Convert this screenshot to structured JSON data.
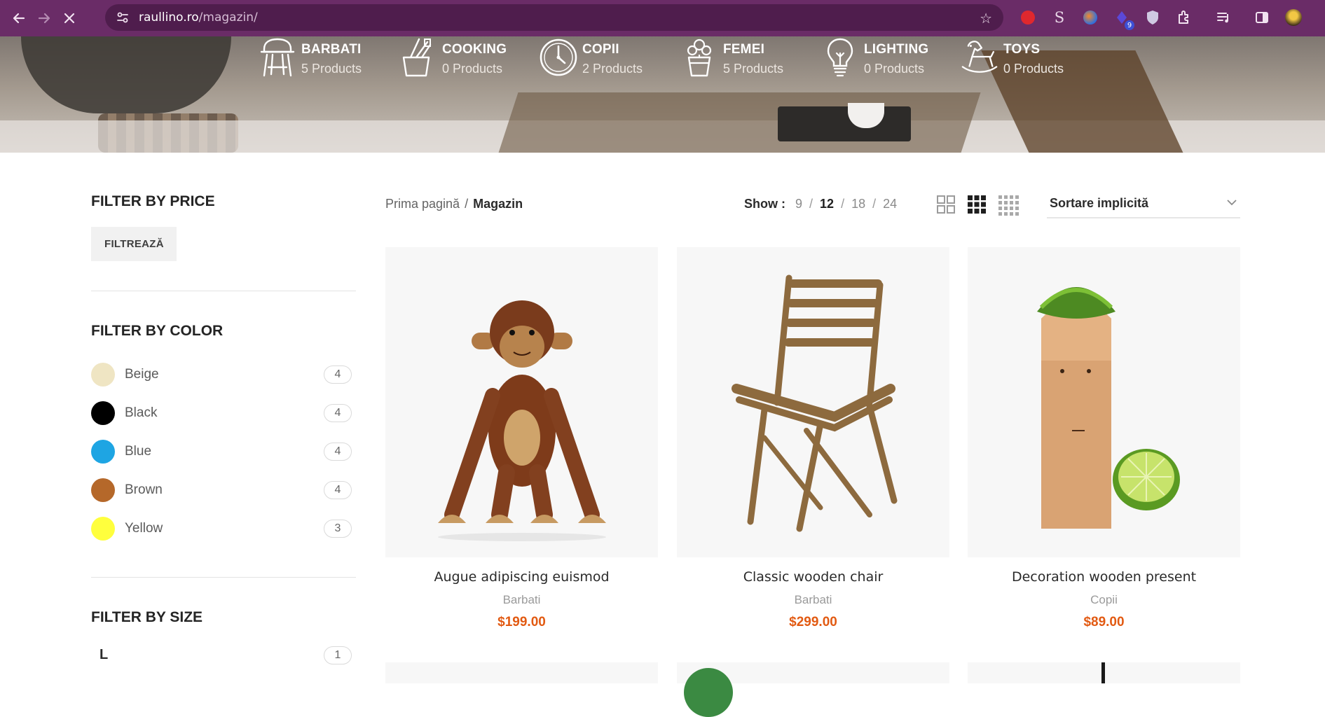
{
  "browser": {
    "url_host": "raullino.ro",
    "url_path": "/magazin/",
    "ext_badge": "9"
  },
  "categories": [
    {
      "name": "BARBATI",
      "count": "5 Products",
      "icon": "chair-icon"
    },
    {
      "name": "COOKING",
      "count": "0 Products",
      "icon": "knife-block-icon"
    },
    {
      "name": "COPII",
      "count": "2 Products",
      "icon": "clock-icon"
    },
    {
      "name": "FEMEI",
      "count": "5 Products",
      "icon": "flower-pot-icon"
    },
    {
      "name": "LIGHTING",
      "count": "0 Products",
      "icon": "lightbulb-icon"
    },
    {
      "name": "TOYS",
      "count": "0 Products",
      "icon": "rocking-horse-icon"
    }
  ],
  "sidebar": {
    "price_title": "FILTER BY PRICE",
    "filter_button": "FILTREAZĂ",
    "color_title": "FILTER BY COLOR",
    "colors": [
      {
        "label": "Beige",
        "count": "4",
        "hex": "#efe5c3"
      },
      {
        "label": "Black",
        "count": "4",
        "hex": "#000000"
      },
      {
        "label": "Blue",
        "count": "4",
        "hex": "#1ea5e3"
      },
      {
        "label": "Brown",
        "count": "4",
        "hex": "#b5682a"
      },
      {
        "label": "Yellow",
        "count": "3",
        "hex": "#ffff3d"
      }
    ],
    "size_title": "FILTER BY SIZE",
    "sizes": [
      {
        "label": "L",
        "count": "1"
      }
    ]
  },
  "breadcrumb": {
    "home": "Prima pagină",
    "sep": "/",
    "current": "Magazin"
  },
  "show": {
    "label": "Show :",
    "options": [
      "9",
      "12",
      "18",
      "24"
    ],
    "active": "12",
    "sep": "/"
  },
  "sort": {
    "selected": "Sortare implicită"
  },
  "products": [
    {
      "name": "Augue adipiscing euismod",
      "category": "Barbati",
      "price": "$199.00"
    },
    {
      "name": "Classic wooden chair",
      "category": "Barbati",
      "price": "$299.00"
    },
    {
      "name": "Decoration wooden present",
      "category": "Copii",
      "price": "$89.00"
    }
  ],
  "colors": {
    "chrome_bg": "#6a2c67",
    "price": "#e25a12"
  }
}
